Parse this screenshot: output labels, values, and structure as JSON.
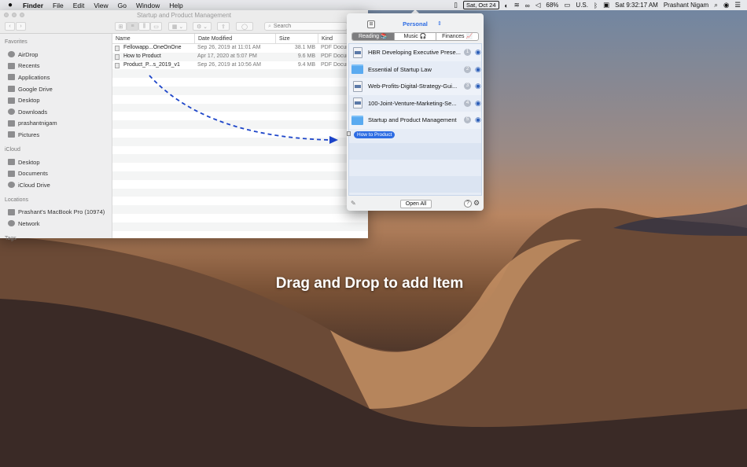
{
  "menubar": {
    "apple": "",
    "items": [
      "Finder",
      "File",
      "Edit",
      "View",
      "Go",
      "Window",
      "Help"
    ],
    "date_badge": "Sat, Oct 24",
    "battery": "68%",
    "input_source": "U.S.",
    "clock": "Sat 9:32:17 AM",
    "user": "Prashant Nigam"
  },
  "finder": {
    "title": "Startup and Product Management",
    "search_placeholder": "Search",
    "sidebar": {
      "favorites_header": "Favorites",
      "favorites": [
        "AirDrop",
        "Recents",
        "Applications",
        "Google Drive",
        "Desktop",
        "Downloads",
        "prashantnigam",
        "Pictures"
      ],
      "icloud_header": "iCloud",
      "icloud": [
        "Desktop",
        "Documents",
        "iCloud Drive"
      ],
      "locations_header": "Locations",
      "locations": [
        "Prashant's MacBook Pro (10974)",
        "Network"
      ],
      "tags_header": "Tags"
    },
    "columns": {
      "name": "Name",
      "date": "Date Modified",
      "size": "Size",
      "kind": "Kind"
    },
    "rows": [
      {
        "name": "Fellowapp...OneOnOne",
        "date": "Sep 26, 2019 at 11:01 AM",
        "size": "38.1 MB",
        "kind": "PDF Document"
      },
      {
        "name": "How to Product",
        "date": "Apr 17, 2020 at 5:07 PM",
        "size": "9.6 MB",
        "kind": "PDF Document"
      },
      {
        "name": "Product_P...s_2019_v1",
        "date": "Sep 26, 2019 at 10:56 AM",
        "size": "9.4 MB",
        "kind": "PDF Document"
      }
    ]
  },
  "popover": {
    "profile": "Personal",
    "grid_icon": "⊞",
    "tabs": [
      "Reading 📚",
      "Music 🎧",
      "Finances 📈"
    ],
    "active_tab": 0,
    "items": [
      {
        "name": "HBR Developing Executive Prese...",
        "num": "1",
        "type": "doc"
      },
      {
        "name": "Essential of Startup Law",
        "num": "2",
        "type": "folder"
      },
      {
        "name": "Web-Profits-Digital-Strategy-Gui...",
        "num": "3",
        "type": "doc"
      },
      {
        "name": "100-Joint-Venture-Marketing-Se...",
        "num": "4",
        "type": "doc"
      },
      {
        "name": "Startup and Product Management",
        "num": "5",
        "type": "folder"
      }
    ],
    "drop_label": "How to Product",
    "open_all": "Open All",
    "help": "?"
  },
  "caption": "Drag and Drop to add Item"
}
